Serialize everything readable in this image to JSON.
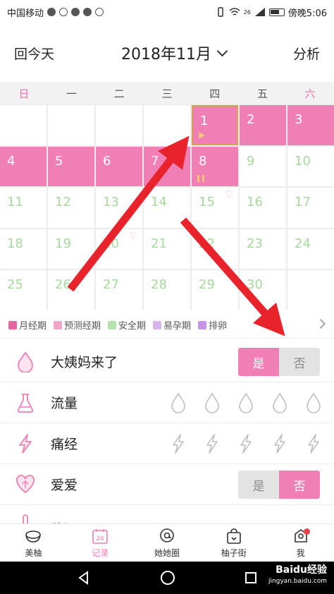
{
  "statusbar": {
    "carrier": "中国移动",
    "signal_badge": "26",
    "time": "傍晚5:06"
  },
  "header": {
    "back_today": "回今天",
    "month": "2018年11月",
    "analysis": "分析"
  },
  "weekdays": [
    "日",
    "一",
    "二",
    "三",
    "四",
    "五",
    "六"
  ],
  "calendar": {
    "cells": [
      {
        "day": "",
        "type": "empty"
      },
      {
        "day": "",
        "type": "empty"
      },
      {
        "day": "",
        "type": "empty"
      },
      {
        "day": "",
        "type": "empty"
      },
      {
        "day": "1",
        "type": "period",
        "selected": true,
        "marker": "start"
      },
      {
        "day": "2",
        "type": "period"
      },
      {
        "day": "3",
        "type": "period"
      },
      {
        "day": "4",
        "type": "period"
      },
      {
        "day": "5",
        "type": "period"
      },
      {
        "day": "6",
        "type": "period"
      },
      {
        "day": "7",
        "type": "period"
      },
      {
        "day": "8",
        "type": "period",
        "marker": "pause"
      },
      {
        "day": "9",
        "type": "empty"
      },
      {
        "day": "10",
        "type": "safe"
      },
      {
        "day": "11",
        "type": "safe"
      },
      {
        "day": "12",
        "type": "safe"
      },
      {
        "day": "13",
        "type": "safe"
      },
      {
        "day": "14",
        "type": "safe"
      },
      {
        "day": "15",
        "type": "safe",
        "heart": true
      },
      {
        "day": "16",
        "type": "safe"
      },
      {
        "day": "17",
        "type": "safe"
      },
      {
        "day": "18",
        "type": "safe"
      },
      {
        "day": "19",
        "type": "safe"
      },
      {
        "day": "20",
        "type": "safe",
        "heart": true
      },
      {
        "day": "21",
        "type": "safe"
      },
      {
        "day": "22",
        "type": "safe"
      },
      {
        "day": "23",
        "type": "safe"
      },
      {
        "day": "24",
        "type": "safe"
      },
      {
        "day": "25",
        "type": "safe"
      },
      {
        "day": "26",
        "type": "safe",
        "heart": true
      },
      {
        "day": "27",
        "type": "safe"
      },
      {
        "day": "28",
        "type": "safe"
      },
      {
        "day": "29",
        "type": "safe"
      },
      {
        "day": "30",
        "type": "safe"
      },
      {
        "day": "",
        "type": "empty"
      }
    ]
  },
  "legend": {
    "items": [
      {
        "label": "月经期",
        "color": "#e3679f"
      },
      {
        "label": "预测经期",
        "color": "#f3a4c8"
      },
      {
        "label": "安全期",
        "color": "#b6e2ad"
      },
      {
        "label": "易孕期",
        "color": "#d8b4ee"
      },
      {
        "label": "排卵",
        "color": "#c892e6"
      }
    ]
  },
  "records": {
    "period_came": {
      "label": "大姨妈来了",
      "yes": "是",
      "no": "否",
      "selected": "是"
    },
    "flow": {
      "label": "流量"
    },
    "cramps": {
      "label": "痛经"
    },
    "love": {
      "label": "爱爱",
      "yes": "是",
      "no": "否",
      "selected": "否"
    },
    "partial": {
      "label": "体温"
    }
  },
  "bottomnav": {
    "items": [
      {
        "label": "美柚",
        "icon": "bowl-icon"
      },
      {
        "label": "记录",
        "icon": "calendar-24-icon",
        "badge": "24",
        "active": true
      },
      {
        "label": "她她圈",
        "icon": "at-bubble-icon"
      },
      {
        "label": "柚子街",
        "icon": "shopping-bag-icon"
      },
      {
        "label": "我",
        "icon": "profile-icon"
      }
    ]
  },
  "watermark": {
    "main": "Baidu经验",
    "sub": "jingyan.baidu.com"
  },
  "colors": {
    "accent": "#ef7fb4",
    "safe": "#a6d99c",
    "arrow": "#e8232c"
  }
}
